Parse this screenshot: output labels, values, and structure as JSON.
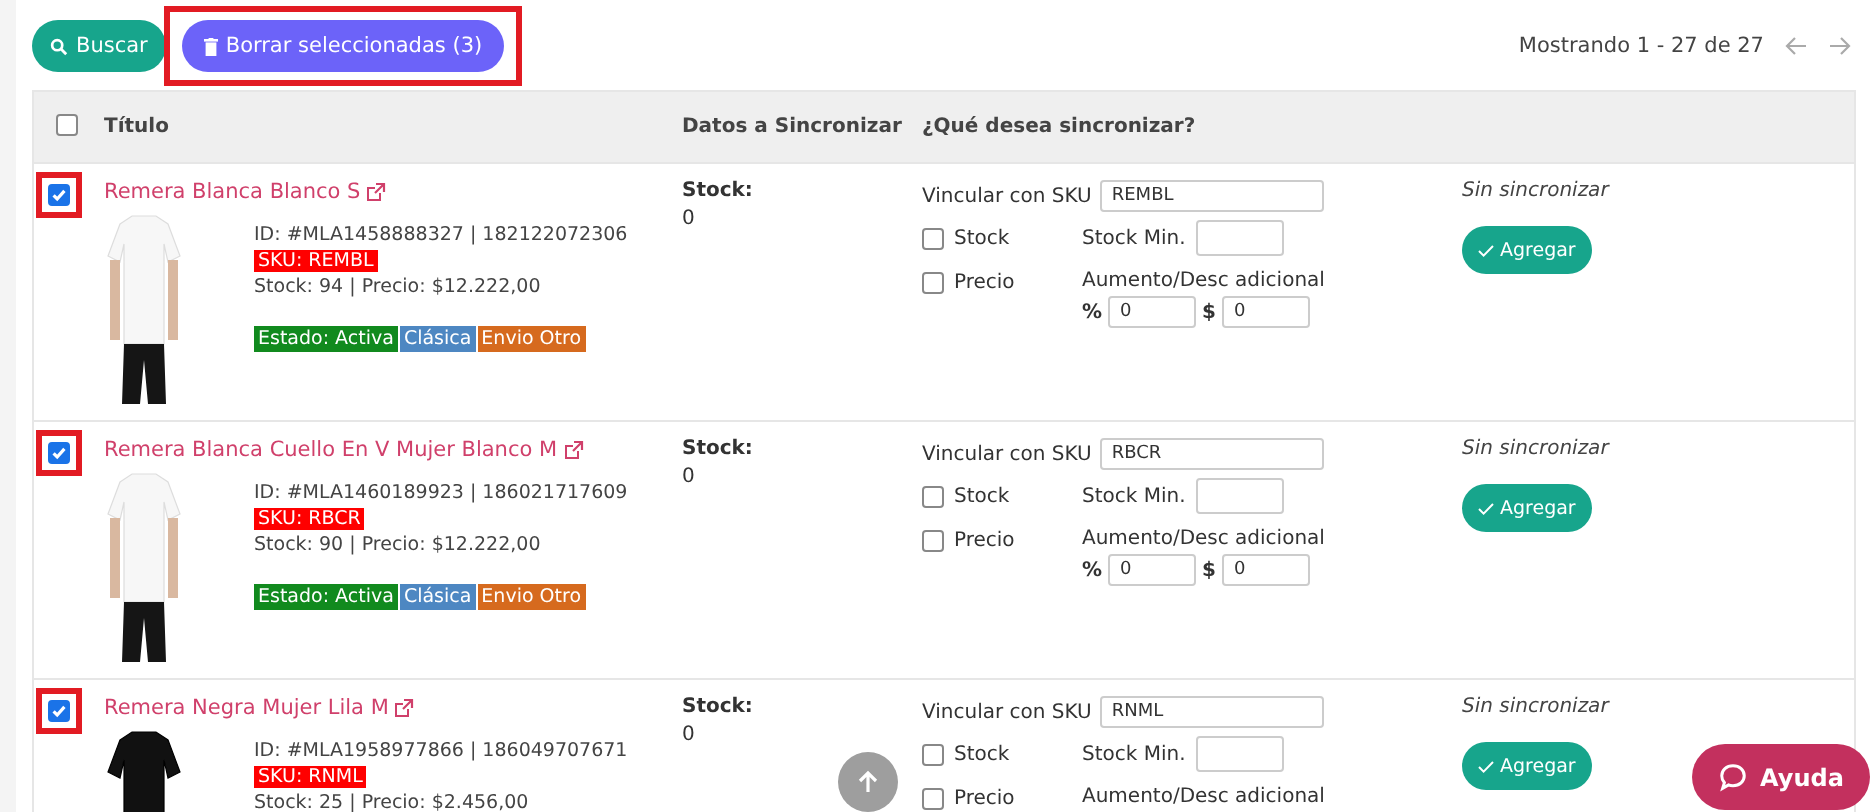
{
  "toolbar": {
    "search_button": "Buscar",
    "delete_button": "Borrar seleccionadas (3)",
    "delete_highlighted": true
  },
  "pagination": {
    "text": "Mostrando 1 - 27 de 27"
  },
  "table": {
    "select_all": {
      "checked": false
    },
    "columns": [
      "Título",
      "Datos a Sincronizar",
      "¿Qué desea sincronizar?"
    ],
    "rows": [
      {
        "checked": true,
        "highlighted": true,
        "title": "Remera Blanca Blanco S",
        "id_line": "ID: #MLA1458888327 | 182122072306",
        "sku": "SKU: REMBL",
        "stock_line": "Stock: 94 | Precio: $12.222,00",
        "badges": [
          {
            "text": "Estado: Activa",
            "color": "#118a1e"
          },
          {
            "text": "Clásica",
            "color": "#4d87c2"
          },
          {
            "text": "Envio Otro",
            "color": "#d66a1e"
          }
        ],
        "data_label": "Stock:",
        "data_value": "0",
        "sync": {
          "sku_label": "Vincular con SKU",
          "sku_value": "REMBL",
          "stock": {
            "label": "Stock",
            "checked": false
          },
          "stock_min_label": "Stock Min.",
          "price": {
            "label": "Precio",
            "checked": false
          },
          "adjust_label": "Aumento/Desc adicional",
          "percent_label": "%",
          "percent_value": "0",
          "amount_label": "$",
          "amount_value": "0"
        },
        "status": "Sin sincronizar",
        "action": "Agregar"
      },
      {
        "checked": true,
        "highlighted": true,
        "title": "Remera Blanca Cuello En V Mujer Blanco M",
        "id_line": "ID: #MLA1460189923 | 186021717609",
        "sku": "SKU: RBCR",
        "stock_line": "Stock: 90 | Precio: $12.222,00",
        "badges": [
          {
            "text": "Estado: Activa",
            "color": "#118a1e"
          },
          {
            "text": "Clásica",
            "color": "#4d87c2"
          },
          {
            "text": "Envio Otro",
            "color": "#d66a1e"
          }
        ],
        "data_label": "Stock:",
        "data_value": "0",
        "sync": {
          "sku_label": "Vincular con SKU",
          "sku_value": "RBCR",
          "stock": {
            "label": "Stock",
            "checked": false
          },
          "stock_min_label": "Stock Min.",
          "price": {
            "label": "Precio",
            "checked": false
          },
          "adjust_label": "Aumento/Desc adicional",
          "percent_label": "%",
          "percent_value": "0",
          "amount_label": "$",
          "amount_value": "0"
        },
        "status": "Sin sincronizar",
        "action": "Agregar"
      },
      {
        "checked": true,
        "highlighted": true,
        "title": "Remera Negra Mujer Lila M",
        "id_line": "ID: #MLA1958977866 | 186049707671",
        "sku": "SKU: RNML",
        "stock_line": "Stock: 25 | Precio: $2.456,00",
        "data_label": "Stock:",
        "data_value": "0",
        "sync": {
          "sku_label": "Vincular con SKU",
          "sku_value": "RNML",
          "stock": {
            "label": "Stock",
            "checked": false
          },
          "stock_min_label": "Stock Min.",
          "price": {
            "label": "Precio",
            "checked": false
          },
          "adjust_label": "Aumento/Desc adicional"
        },
        "status": "Sin sincronizar",
        "action": "Agregar"
      }
    ]
  },
  "help_button": "Ayuda"
}
